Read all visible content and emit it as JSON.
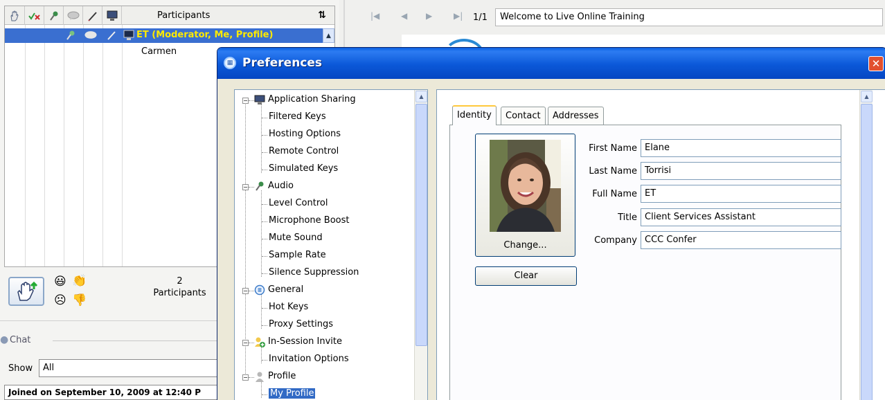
{
  "participants": {
    "header": "Participants",
    "rows": [
      {
        "name": "ET (Moderator, Me, Profile)"
      },
      {
        "name": "Carmen"
      }
    ],
    "count_value": "2",
    "count_label": "Participants"
  },
  "chat": {
    "label": "Chat",
    "show_label": "Show",
    "show_value": "All",
    "joined_text": "Joined on September 10, 2009 at 12:40 P"
  },
  "presentation": {
    "page_info": "1/1",
    "slide_title": "Welcome to Live Online Training"
  },
  "preferences": {
    "title": "Preferences",
    "close_glyph": "✕",
    "tree": [
      {
        "label": "Application Sharing",
        "children": [
          "Filtered Keys",
          "Hosting Options",
          "Remote Control",
          "Simulated Keys"
        ]
      },
      {
        "label": "Audio",
        "children": [
          "Level Control",
          "Microphone Boost",
          "Mute Sound",
          "Sample Rate",
          "Silence Suppression"
        ]
      },
      {
        "label": "General",
        "children": [
          "Hot Keys",
          "Proxy Settings"
        ]
      },
      {
        "label": "In-Session Invite",
        "children": [
          "Invitation Options"
        ]
      },
      {
        "label": "Profile",
        "children": [
          "My Profile"
        ]
      }
    ],
    "selected_item": "My Profile",
    "tabs": [
      "Identity",
      "Contact",
      "Addresses"
    ],
    "active_tab": "Identity",
    "photo_button": "Change...",
    "clear_button": "Clear",
    "fields": [
      {
        "label": "First Name",
        "value": "Elane"
      },
      {
        "label": "Last Name",
        "value": "Torrisi"
      },
      {
        "label": "Full Name",
        "value": "ET"
      },
      {
        "label": "Title",
        "value": "Client Services Assistant"
      },
      {
        "label": "Company",
        "value": "CCC Confer"
      }
    ]
  },
  "colors": {
    "selection_blue": "#3a6fd0",
    "moderator_yellow": "#ffea00",
    "titlebar_blue": "#0b58d8",
    "close_red": "#e2502e",
    "tab_accent": "#ffc83c"
  }
}
